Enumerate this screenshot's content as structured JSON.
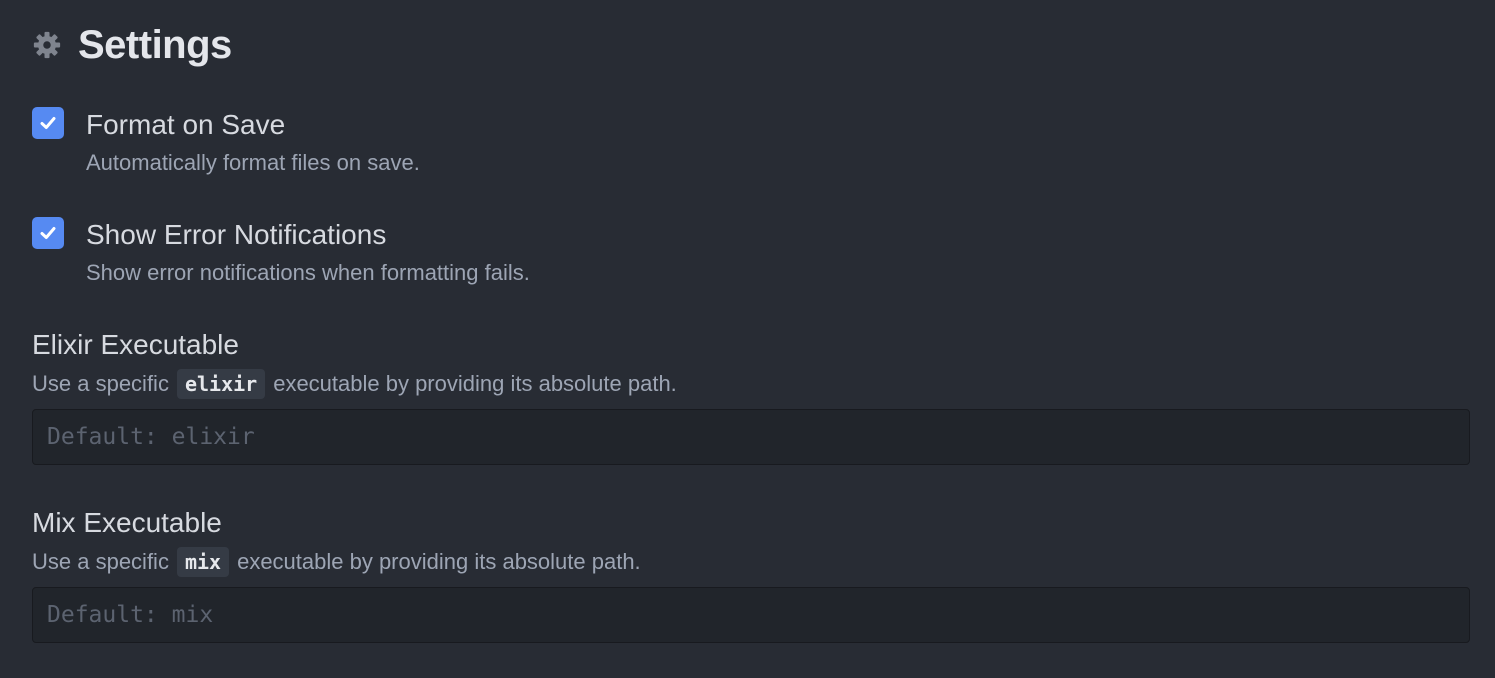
{
  "header": {
    "title": "Settings",
    "icon": "gear-icon"
  },
  "checkbox_settings": [
    {
      "label": "Format on Save",
      "description": "Automatically format files on save.",
      "checked": true
    },
    {
      "label": "Show Error Notifications",
      "description": "Show error notifications when formatting fails.",
      "checked": true
    }
  ],
  "text_settings": [
    {
      "label": "Elixir Executable",
      "description_prefix": "Use a specific",
      "code": "elixir",
      "description_suffix": "executable by providing its absolute path.",
      "placeholder": "Default: elixir",
      "value": ""
    },
    {
      "label": "Mix Executable",
      "description_prefix": "Use a specific",
      "code": "mix",
      "description_suffix": "executable by providing its absolute path.",
      "placeholder": "Default: mix",
      "value": ""
    }
  ],
  "colors": {
    "background": "#282c34",
    "accent": "#568af2",
    "input_background": "#21252b",
    "muted_text": "#9da5b4"
  }
}
